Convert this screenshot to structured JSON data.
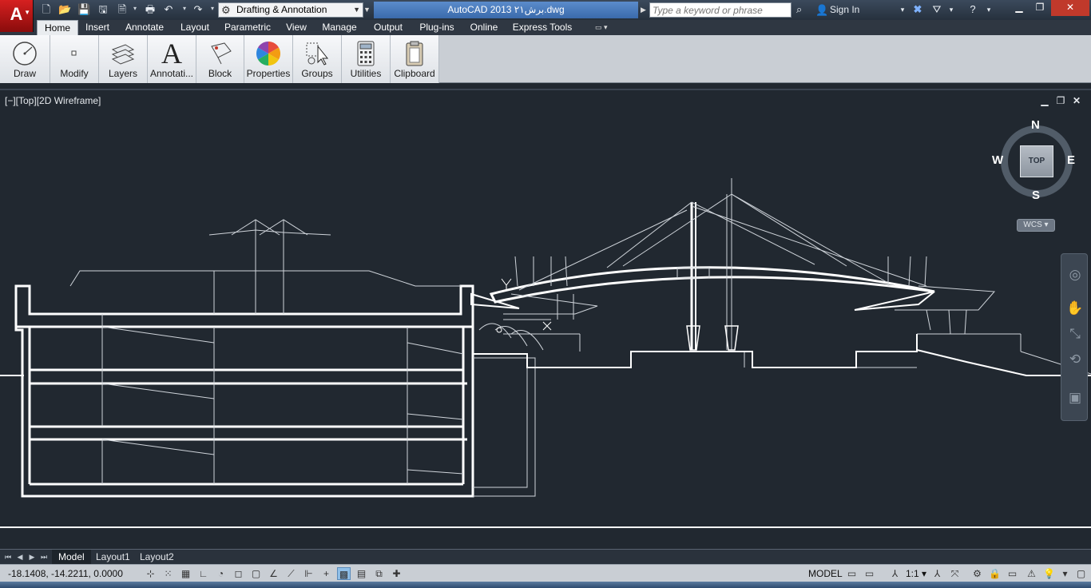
{
  "app": {
    "logo_letter": "A",
    "title": "AutoCAD 2013    برش۲۱.dwg",
    "workspace": "Drafting & Annotation",
    "search_placeholder": "Type a keyword or phrase",
    "sign_in": "Sign In"
  },
  "ribbon": {
    "tabs": [
      "Home",
      "Insert",
      "Annotate",
      "Layout",
      "Parametric",
      "View",
      "Manage",
      "Output",
      "Plug-ins",
      "Online",
      "Express Tools"
    ],
    "active_tab": "Home",
    "panels": [
      "Draw",
      "Modify",
      "Layers",
      "Annotati...",
      "Block",
      "Properties",
      "Groups",
      "Utilities",
      "Clipboard"
    ]
  },
  "viewport": {
    "label": "[−][Top][2D Wireframe]",
    "viewcube": {
      "face": "TOP",
      "north": "N",
      "south": "S",
      "east": "E",
      "west": "W"
    },
    "ucs": "WCS"
  },
  "layout_tabs": [
    "Model",
    "Layout1",
    "Layout2"
  ],
  "status": {
    "coordinates": "-18.1408, -14.2211, 0.0000",
    "space": "MODEL",
    "annotation_scale": "1:1"
  },
  "colors": {
    "canvas": "#212830",
    "linework": "#ffffff",
    "title_highlight": "#4a7cbf",
    "ribbon": "#dde1e6"
  }
}
